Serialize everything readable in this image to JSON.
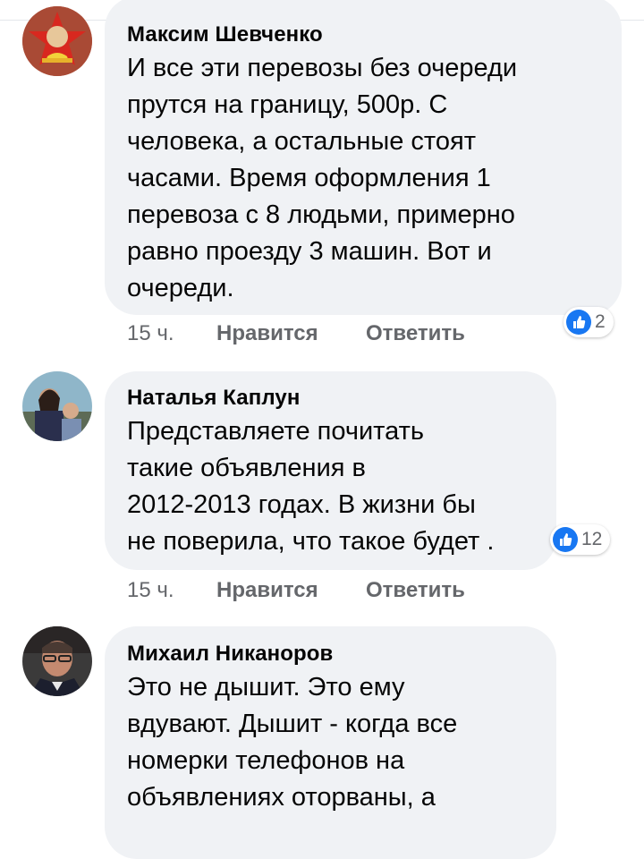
{
  "comments": [
    {
      "author": "Максим Шевченко",
      "text": "И все эти перевозы без очереди\nпрутся на границу, 500р. С\nчеловека, а остальные стоят\nчасами. Время оформления 1\nперевоза с 8 людьми, примерно\nравно проезду 3 машин. Вот и\nочереди.",
      "time": "15 ч.",
      "like_label": "Нравится",
      "reply_label": "Ответить",
      "reaction_count": "2",
      "reaction_icon": "like-icon",
      "avatar_icon": "pioneer-badge-avatar"
    },
    {
      "author": "Наталья Каплун",
      "text": "Представляете почитать\nтакие объявления в\n2012-2013 годах. В жизни бы\nне поверила, что такое будет .",
      "time": "15 ч.",
      "like_label": "Нравится",
      "reply_label": "Ответить",
      "reaction_count": "12",
      "reaction_icon": "like-icon",
      "avatar_icon": "photo-avatar"
    },
    {
      "author": "Михаил Никаноров",
      "text": "Это не дышит. Это ему\nвдувают. Дышит - когда все\nномерки телефонов на\nобъявлениях оторваны, а",
      "avatar_icon": "photo-avatar"
    }
  ],
  "colors": {
    "bubble": "#f0f2f5",
    "like_blue": "#1877f2",
    "meta_gray": "#65676b"
  }
}
